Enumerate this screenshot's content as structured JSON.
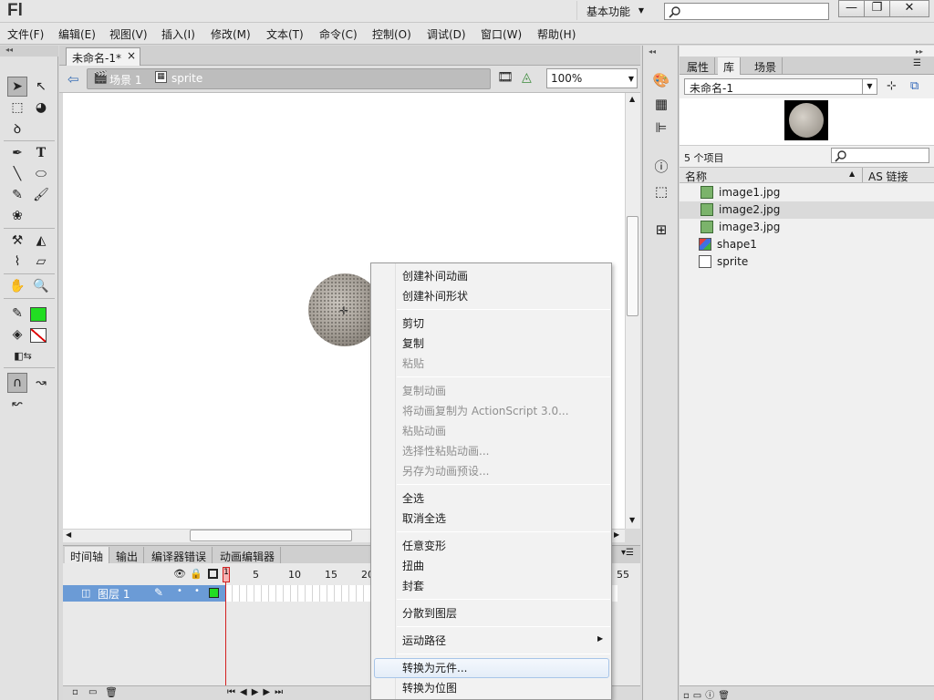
{
  "app": {
    "logo": "Fl",
    "workspace": "基本功能",
    "search_placeholder": ""
  },
  "menu": [
    "文件(F)",
    "编辑(E)",
    "视图(V)",
    "插入(I)",
    "修改(M)",
    "文本(T)",
    "命令(C)",
    "控制(O)",
    "调试(D)",
    "窗口(W)",
    "帮助(H)"
  ],
  "document": {
    "tab_title": "未命名-1*",
    "breadcrumb_scene": "场景 1",
    "breadcrumb_symbol": "sprite",
    "zoom": "100%"
  },
  "timeline": {
    "tabs": [
      "时间轴",
      "输出",
      "编译器错误",
      "动画编辑器"
    ],
    "frame_numbers": [
      "1",
      "5",
      "10",
      "15",
      "20",
      "55"
    ],
    "layer_name": "图层 1"
  },
  "library": {
    "tabs": [
      "属性",
      "库",
      "场景"
    ],
    "document": "未命名-1",
    "items_count": "5 个项目",
    "col_name": "名称",
    "col_linkage": "AS 链接",
    "items": [
      {
        "label": "image1.jpg",
        "type": "bitmap"
      },
      {
        "label": "image2.jpg",
        "type": "bitmap"
      },
      {
        "label": "image3.jpg",
        "type": "bitmap"
      },
      {
        "label": "shape1",
        "type": "graphic"
      },
      {
        "label": "sprite",
        "type": "movieclip"
      }
    ]
  },
  "context_menu": {
    "items": [
      "创建补间动画",
      "创建补间形状",
      "剪切",
      "复制",
      "粘贴",
      "复制动画",
      "将动画复制为 ActionScript 3.0...",
      "粘贴动画",
      "选择性粘贴动画...",
      "另存为动画预设...",
      "全选",
      "取消全选",
      "任意变形",
      "扭曲",
      "封套",
      "分散到图层",
      "运动路径",
      "转换为元件...",
      "转换为位图"
    ]
  },
  "colors": {
    "fill_color": "#22dd22",
    "layer_highlight": "#6b9bd6",
    "playhead": "#d32020"
  }
}
